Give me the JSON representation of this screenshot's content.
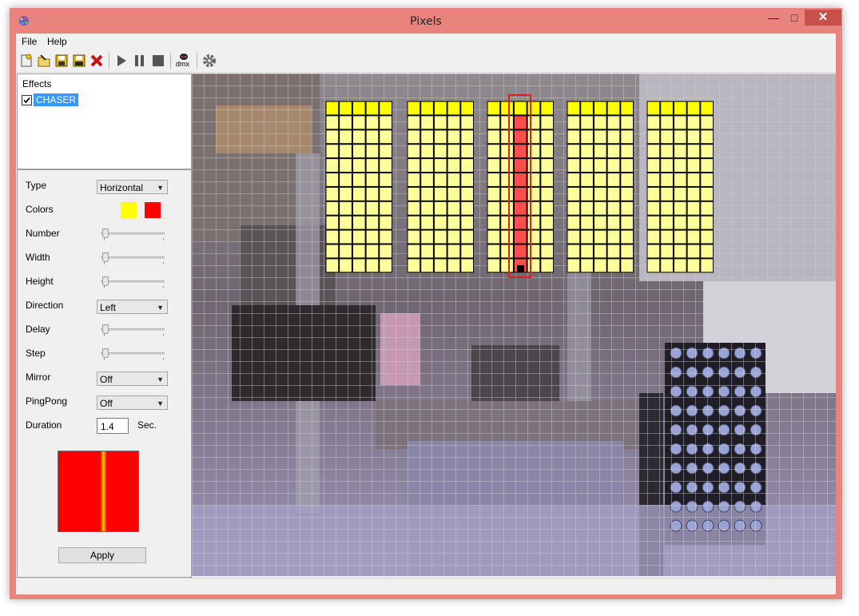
{
  "window": {
    "title": "Pixels"
  },
  "menu": {
    "file": "File",
    "help": "Help"
  },
  "toolbar": {
    "dmx_label": "dmx"
  },
  "effects": {
    "label": "Effects",
    "items": [
      {
        "name": "CHASER",
        "checked": true
      }
    ]
  },
  "properties": {
    "type_label": "Type",
    "type_value": "Horizontal",
    "colors_label": "Colors",
    "color1": "#ffff00",
    "color2": "#ff0000",
    "number_label": "Number",
    "width_label": "Width",
    "height_label": "Height",
    "direction_label": "Direction",
    "direction_value": "Left",
    "delay_label": "Delay",
    "step_label": "Step",
    "mirror_label": "Mirror",
    "mirror_value": "Off",
    "pingpong_label": "PingPong",
    "pingpong_value": "Off",
    "duration_label": "Duration",
    "duration_value": "1.4",
    "duration_unit": "Sec.",
    "apply_label": "Apply"
  },
  "canvas": {
    "fixture_color": "#ffff99",
    "top_color": "#ffff00",
    "highlight_color": "#ff4d4d"
  }
}
